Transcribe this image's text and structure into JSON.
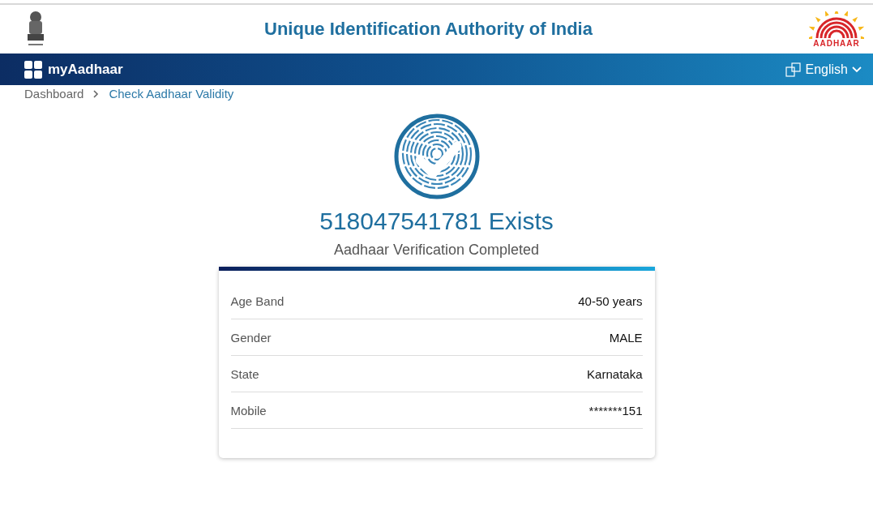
{
  "header": {
    "title": "Unique Identification Authority of India",
    "logo_text": "AADHAAR"
  },
  "navbar": {
    "brand": "myAadhaar",
    "language": "English"
  },
  "breadcrumb": [
    {
      "label": "Dashboard",
      "selected": false
    },
    {
      "label": "Check Aadhaar Validity",
      "selected": true
    }
  ],
  "result": {
    "heading": "518047541781 Exists",
    "subheading": "Aadhaar Verification Completed"
  },
  "details": [
    {
      "label": "Age Band",
      "value": "40-50 years"
    },
    {
      "label": "Gender",
      "value": "MALE"
    },
    {
      "label": "State",
      "value": "Karnataka"
    },
    {
      "label": "Mobile",
      "value": "*******151"
    }
  ]
}
